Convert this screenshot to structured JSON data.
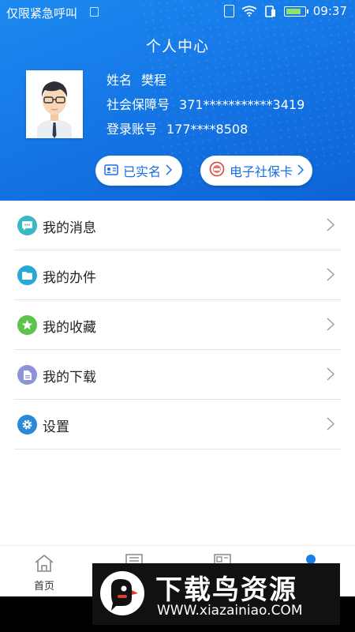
{
  "status": {
    "carrier": "仅限紧急呼叫",
    "time": "09:37"
  },
  "header": {
    "title": "个人中心",
    "name_label": "姓名",
    "name_value": "樊程",
    "ssn_label": "社会保障号",
    "ssn_value": "371***********3419",
    "account_label": "登录账号",
    "account_value": "177****8508",
    "verified_label": "已实名",
    "card_label": "电子社保卡"
  },
  "menu": [
    {
      "label": "我的消息",
      "icon": "message-icon",
      "color": "#39b9c5"
    },
    {
      "label": "我的办件",
      "icon": "folder-icon",
      "color": "#27a8d8"
    },
    {
      "label": "我的收藏",
      "icon": "star-icon",
      "color": "#5cc44a"
    },
    {
      "label": "我的下载",
      "icon": "download-icon",
      "color": "#8d93d8"
    },
    {
      "label": "设置",
      "icon": "gear-icon",
      "color": "#2a8ad8"
    }
  ],
  "tabbar": {
    "home_label": "首页"
  },
  "watermark": {
    "title": "下载鸟资源",
    "url": "WWW.xiazainiao.COM"
  },
  "colors": {
    "header_start": "#1d8af0",
    "header_end": "#0e63d6",
    "accent": "#1a6fe0"
  }
}
